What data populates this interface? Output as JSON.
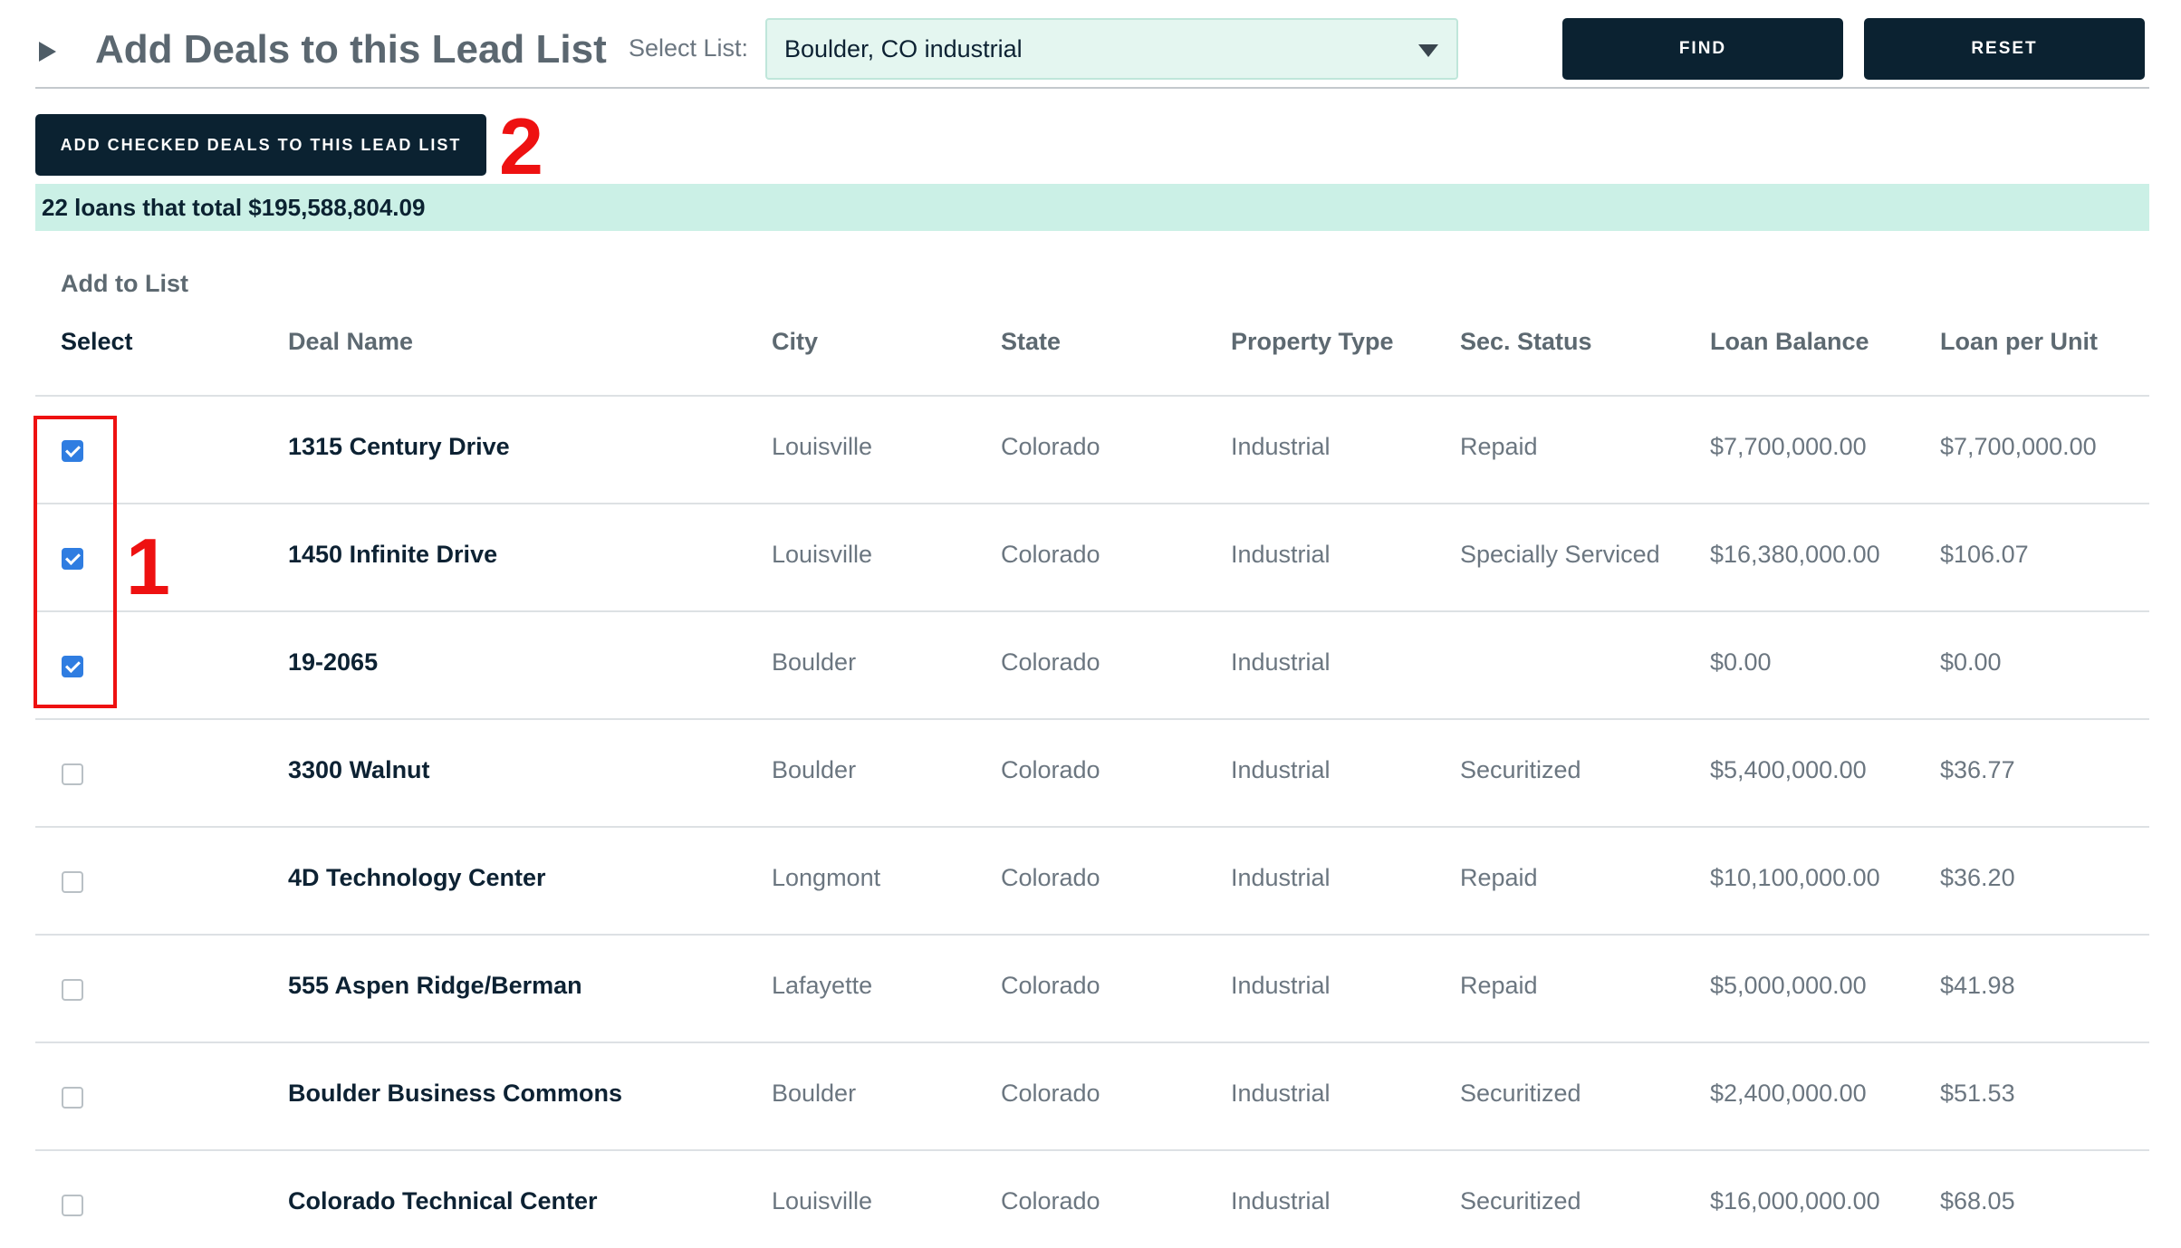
{
  "header": {
    "title": "Add Deals to this Lead List",
    "select_label": "Select List:",
    "selected_list": "Boulder, CO industrial",
    "find_label": "FIND",
    "reset_label": "RESET"
  },
  "add_checked_label": "ADD CHECKED DEALS TO THIS LEAD LIST",
  "markers": {
    "one": "1",
    "two": "2"
  },
  "summary": "22 loans that total $195,588,804.09",
  "table": {
    "caption": "Add to List",
    "columns": [
      "Select",
      "Deal Name",
      "City",
      "State",
      "Property Type",
      "Sec. Status",
      "Loan Balance",
      "Loan per Unit"
    ],
    "rows": [
      {
        "checked": true,
        "deal": "1315 Century Drive",
        "city": "Louisville",
        "state": "Colorado",
        "type": "Industrial",
        "status": "Repaid",
        "balance": "$7,700,000.00",
        "per_unit": "$7,700,000.00"
      },
      {
        "checked": true,
        "deal": "1450 Infinite Drive",
        "city": "Louisville",
        "state": "Colorado",
        "type": "Industrial",
        "status": "Specially Serviced",
        "balance": "$16,380,000.00",
        "per_unit": "$106.07"
      },
      {
        "checked": true,
        "deal": "19-2065",
        "city": "Boulder",
        "state": "Colorado",
        "type": "Industrial",
        "status": "",
        "balance": "$0.00",
        "per_unit": "$0.00"
      },
      {
        "checked": false,
        "deal": "3300 Walnut",
        "city": "Boulder",
        "state": "Colorado",
        "type": "Industrial",
        "status": "Securitized",
        "balance": "$5,400,000.00",
        "per_unit": "$36.77"
      },
      {
        "checked": false,
        "deal": "4D Technology Center",
        "city": "Longmont",
        "state": "Colorado",
        "type": "Industrial",
        "status": "Repaid",
        "balance": "$10,100,000.00",
        "per_unit": "$36.20"
      },
      {
        "checked": false,
        "deal": "555 Aspen Ridge/Berman",
        "city": "Lafayette",
        "state": "Colorado",
        "type": "Industrial",
        "status": "Repaid",
        "balance": "$5,000,000.00",
        "per_unit": "$41.98"
      },
      {
        "checked": false,
        "deal": "Boulder Business Commons",
        "city": "Boulder",
        "state": "Colorado",
        "type": "Industrial",
        "status": "Securitized",
        "balance": "$2,400,000.00",
        "per_unit": "$51.53"
      },
      {
        "checked": false,
        "deal": "Colorado Technical Center",
        "city": "Louisville",
        "state": "Colorado",
        "type": "Industrial",
        "status": "Securitized",
        "balance": "$16,000,000.00",
        "per_unit": "$68.05"
      }
    ]
  },
  "colors": {
    "primary_dark": "#0b2231",
    "summary_bg": "#cbf0e6",
    "select_bg": "#e4f6f0",
    "checkbox_checked": "#2f7de1",
    "annotation_red": "#ee1111"
  },
  "icons": [
    "expand-triangle-icon",
    "dropdown-caret-icon",
    "checkmark-icon"
  ]
}
